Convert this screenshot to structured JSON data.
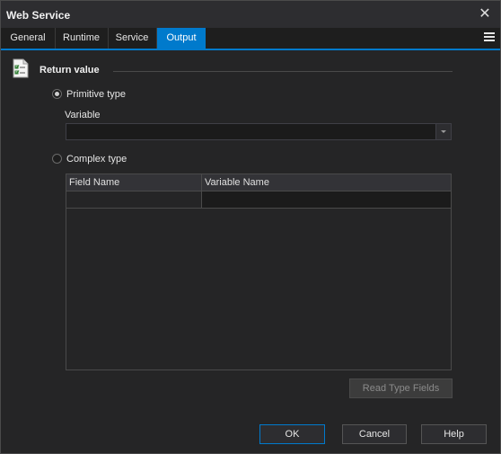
{
  "window": {
    "title": "Web Service"
  },
  "tabs": [
    {
      "label": "General"
    },
    {
      "label": "Runtime"
    },
    {
      "label": "Service"
    },
    {
      "label": "Output"
    }
  ],
  "section": {
    "title": "Return value",
    "icon": "checklist-icon"
  },
  "primitive": {
    "label": "Primitive type",
    "checked": true
  },
  "variable": {
    "label": "Variable",
    "value": ""
  },
  "complex": {
    "label": "Complex type",
    "checked": false
  },
  "grid": {
    "columns": [
      "Field Name",
      "Variable Name"
    ],
    "rows": [
      [
        "",
        ""
      ]
    ]
  },
  "buttons": {
    "read_type_fields": "Read Type Fields",
    "ok": "OK",
    "cancel": "Cancel",
    "help": "Help"
  },
  "colors": {
    "accent": "#007acc",
    "background": "#252526"
  }
}
